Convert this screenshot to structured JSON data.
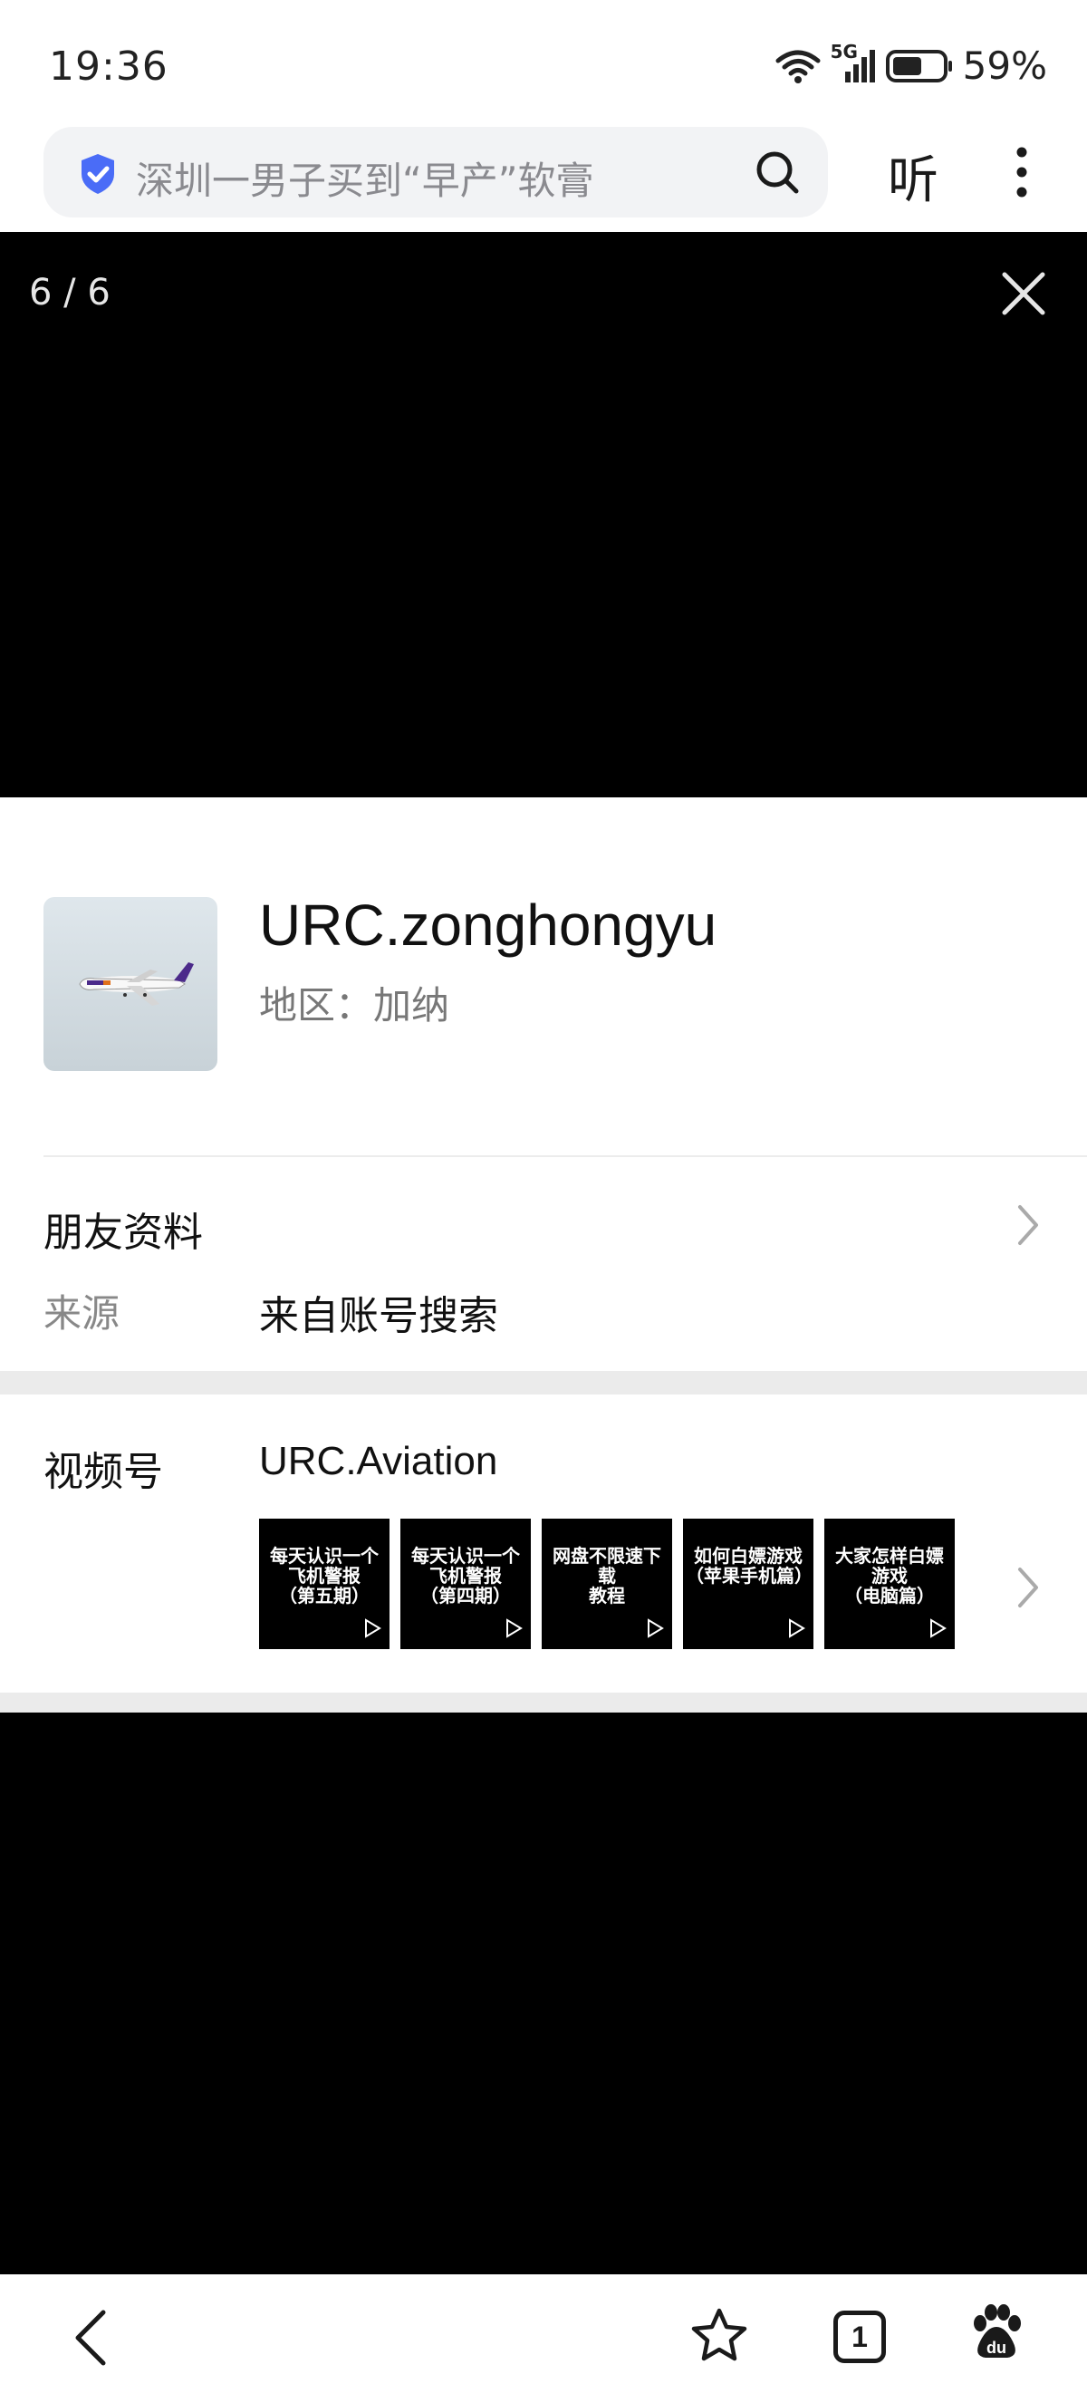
{
  "status_bar": {
    "time": "19:36",
    "network": "5G",
    "battery_level": 59,
    "battery_text": "59%"
  },
  "search": {
    "query": "深圳一男子买到“早产”软膏",
    "listen_label": "听"
  },
  "viewer": {
    "counter": "6 / 6"
  },
  "profile": {
    "name": "URC.zonghongyu",
    "region": "地区：加纳",
    "friend_info_label": "朋友资料",
    "source_label": "来源",
    "source_value": "来自账号搜索",
    "channel_label": "视频号",
    "channel_name": "URC.Aviation",
    "thumbnails": [
      {
        "text": "每天认识一个\n飞机警报\n（第五期）"
      },
      {
        "text": "每天认识一个\n飞机警报\n（第四期）"
      },
      {
        "text": "网盘不限速下载\n教程"
      },
      {
        "text": "如何白嫖游戏\n（苹果手机篇）"
      },
      {
        "text": "大家怎样白嫖游戏\n（电脑篇）"
      }
    ]
  },
  "nav": {
    "tab_count": "1"
  },
  "colors": {
    "accent_blue": "#4a6cf7",
    "text_primary": "#111111",
    "text_secondary": "#888888"
  },
  "icons": [
    "wifi-icon",
    "signal-icon",
    "battery-icon",
    "shield-icon",
    "search-icon",
    "more-icon",
    "close-icon",
    "chevron-right-icon",
    "play-icon",
    "back-icon",
    "star-icon",
    "tabs-icon",
    "baidu-paw-icon"
  ]
}
